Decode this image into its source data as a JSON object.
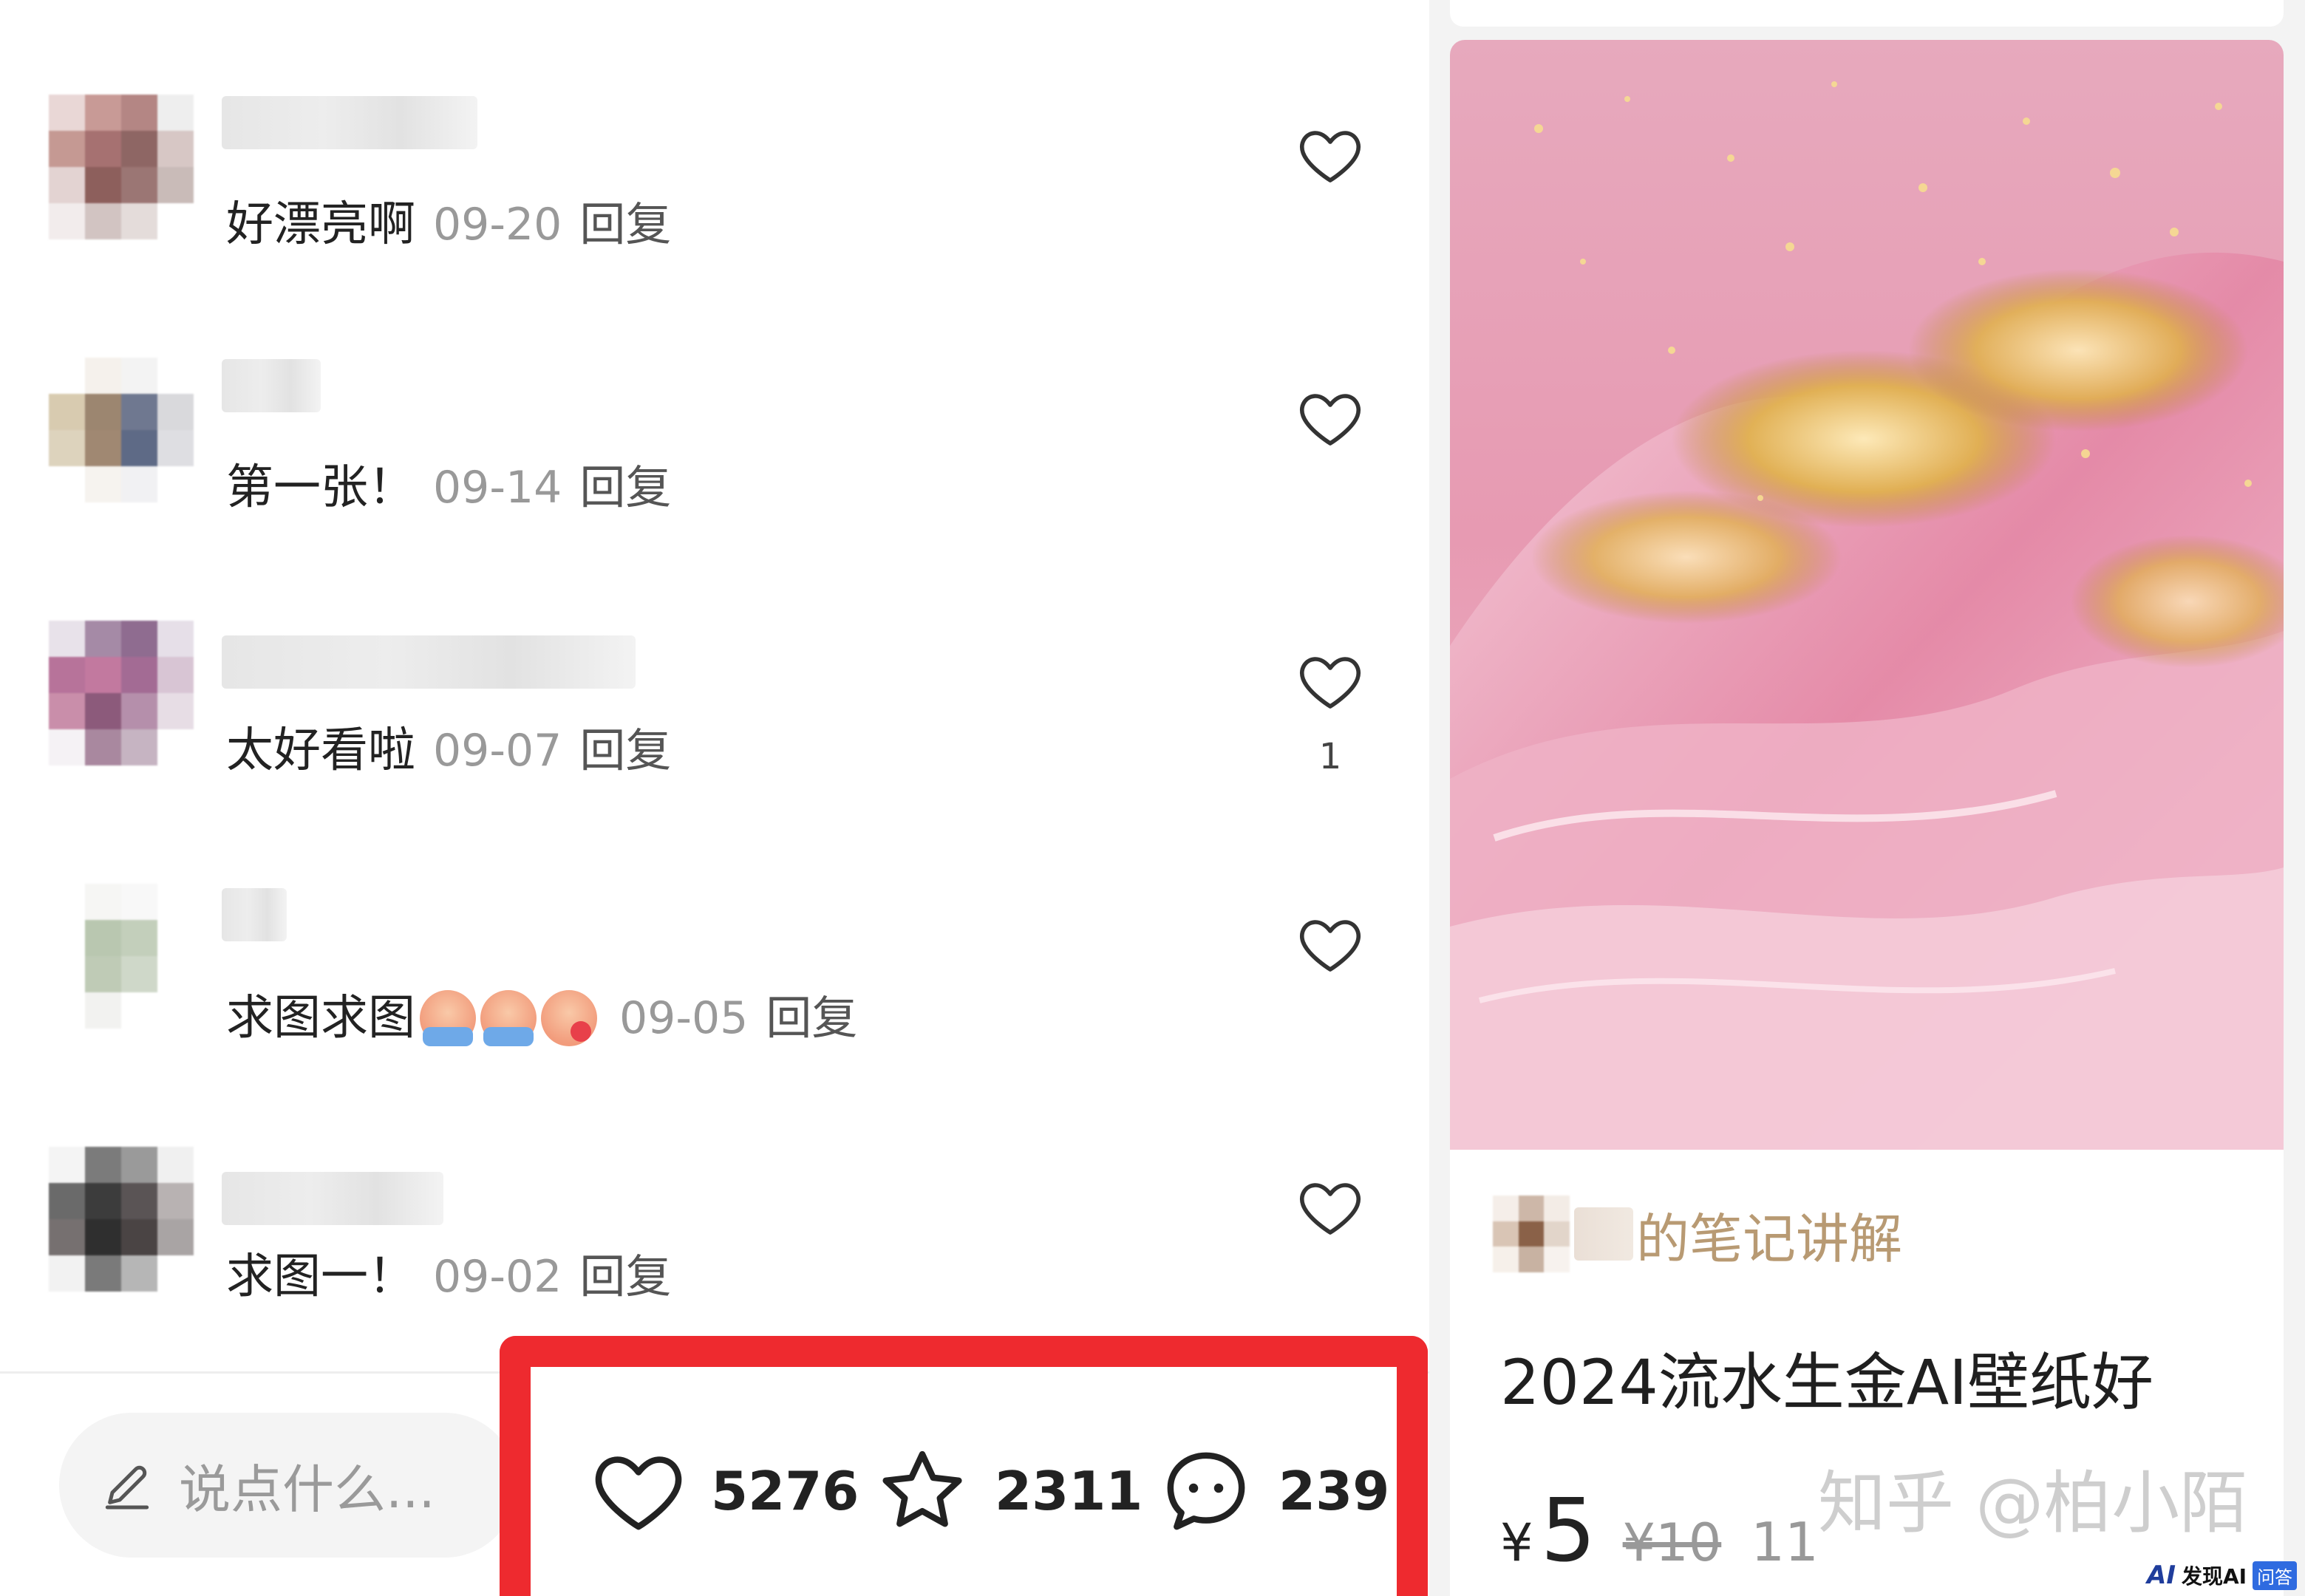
{
  "comments": [
    {
      "text": "好漂亮啊",
      "date": "09-20",
      "reply": "回复",
      "likes": ""
    },
    {
      "text": "第一张！",
      "date": "09-14",
      "reply": "回复",
      "likes": ""
    },
    {
      "text": "太好看啦",
      "date": "09-07",
      "reply": "回复",
      "likes": "1"
    },
    {
      "text": "求图求图",
      "date": "09-05",
      "reply": "回复",
      "likes": ""
    },
    {
      "text": "求图一！",
      "date": "09-02",
      "reply": "回复",
      "likes": ""
    }
  ],
  "input": {
    "placeholder": "说点什么..."
  },
  "stats": {
    "likes": "5276",
    "collects": "2311",
    "comments": "239"
  },
  "note": {
    "author_suffix": "的笔记讲解",
    "title": "2024流水生金AI壁纸好",
    "price_currency": "¥",
    "price": "5",
    "price_original": "¥10",
    "sold": "11"
  },
  "watermark": "知乎 @柏小陌",
  "corner_logo": {
    "mark": "AI",
    "brand": "发现AI",
    "tag": "问答"
  },
  "colors": {
    "highlight_border": "#ee2a2f",
    "author_text": "#b89a73"
  }
}
